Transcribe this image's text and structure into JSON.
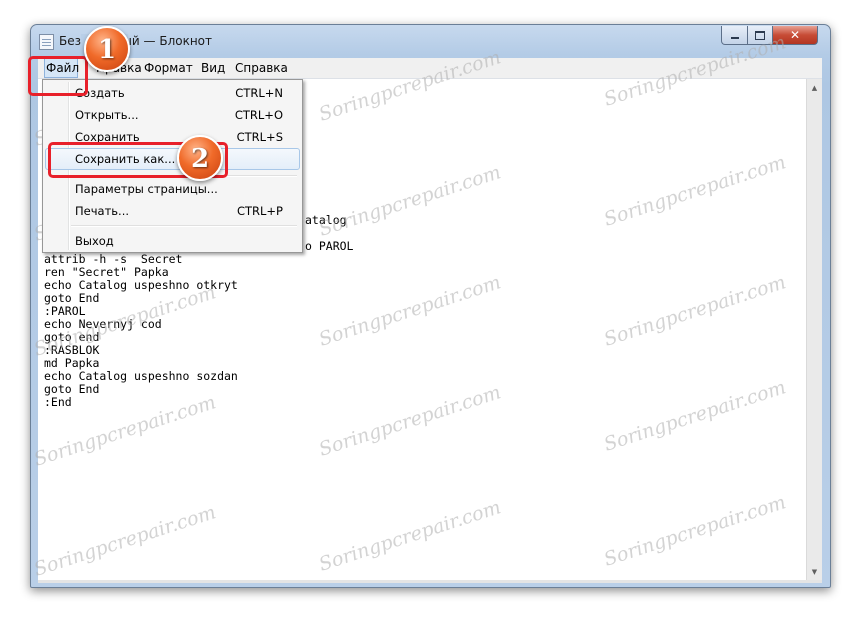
{
  "window": {
    "title": "Безымянный — Блокнот",
    "controls": {
      "close_glyph": "✕"
    }
  },
  "menubar": {
    "items": [
      "Файл",
      "Правка",
      "Формат",
      "Вид",
      "Справка"
    ]
  },
  "file_menu": {
    "items": [
      {
        "label": "Создать",
        "shortcut": "CTRL+N"
      },
      {
        "label": "Открыть...",
        "shortcut": "CTRL+O"
      },
      {
        "label": "Сохранить",
        "shortcut": "CTRL+S"
      },
      {
        "label": "Сохранить как...",
        "shortcut": "",
        "highlighted": true
      },
      {
        "label": "Параметры страницы...",
        "shortcut": ""
      },
      {
        "label": "Печать...",
        "shortcut": "CTRL+P"
      },
      {
        "label": "Выход",
        "shortcut": ""
      }
    ]
  },
  "editor": {
    "visible_fragments": [
      "atalog",
      "o PAROL"
    ],
    "lines": [
      "attrib -h -s  Secret",
      "ren \"Secret\" Papka",
      "echo Catalog uspeshno otkryt",
      "goto End",
      ":PAROL",
      "echo Nevernyj cod",
      "goto end",
      ":RASBLOK",
      "md Papka",
      "echo Catalog uspeshno sozdan",
      "goto End",
      ":End"
    ]
  },
  "annotations": {
    "badge_1": "1",
    "badge_2": "2",
    "highlight_color": "#e8202a",
    "badge_color": "#f06a29"
  },
  "watermark": {
    "text": "Soringpcrepair.com"
  }
}
